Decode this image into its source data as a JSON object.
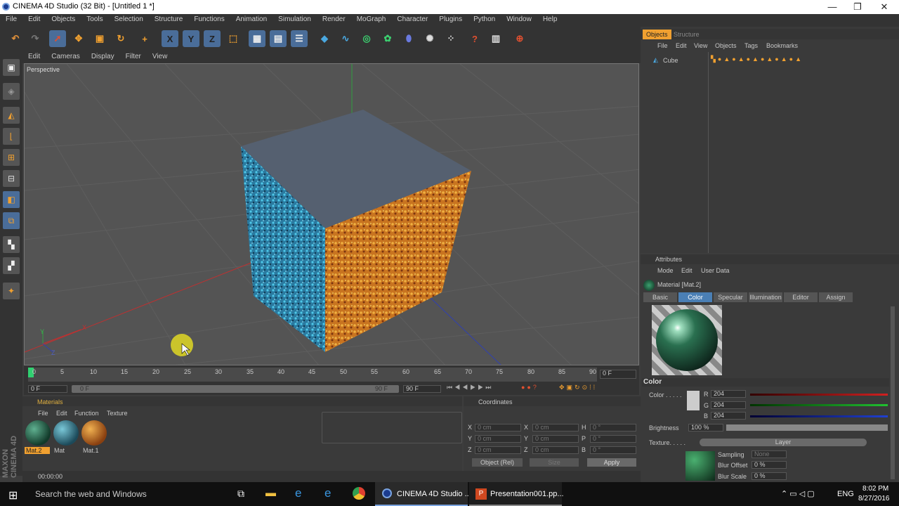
{
  "window": {
    "title": "CINEMA 4D Studio (32 Bit) - [Untitled 1 *]",
    "controls": [
      "—",
      "❐",
      "✕"
    ]
  },
  "menu": [
    "File",
    "Edit",
    "Objects",
    "Tools",
    "Selection",
    "Structure",
    "Functions",
    "Animation",
    "Simulation",
    "Render",
    "MoGraph",
    "Character",
    "Plugins",
    "Python",
    "Window",
    "Help"
  ],
  "viewport": {
    "menu": [
      "Edit",
      "Cameras",
      "Display",
      "Filter",
      "View"
    ],
    "label": "Perspective",
    "axes": {
      "y": "Y",
      "x": "X",
      "z": "Z"
    }
  },
  "toolbar": {
    "x": "X",
    "y": "Y",
    "z": "Z"
  },
  "timeline": {
    "ticks": [
      "0",
      "5",
      "10",
      "15",
      "20",
      "25",
      "30",
      "35",
      "40",
      "45",
      "50",
      "55",
      "60",
      "65",
      "70",
      "75",
      "80",
      "85",
      "90"
    ],
    "current_frame": "0 F",
    "start": "0 F",
    "range_start": "0 F",
    "range_end": "90 F",
    "end": "90 F"
  },
  "materials": {
    "title": "Materials",
    "menu": [
      "File",
      "Edit",
      "Function",
      "Texture"
    ],
    "items": [
      {
        "name": "Mat.2",
        "color": "#1f4a3a"
      },
      {
        "name": "Mat",
        "color": "#2c6a7a"
      },
      {
        "name": "Mat.1",
        "color": "#c87830"
      }
    ]
  },
  "coordinates": {
    "title": "Coordinates",
    "rows": [
      {
        "a": "X",
        "av": "0 cm",
        "b": "X",
        "bv": "0 cm",
        "c": "H",
        "cv": "0 °"
      },
      {
        "a": "Y",
        "av": "0 cm",
        "b": "Y",
        "bv": "0 cm",
        "c": "P",
        "cv": "0 °"
      },
      {
        "a": "Z",
        "av": "0 cm",
        "b": "Z",
        "bv": "0 cm",
        "c": "B",
        "cv": "0 °"
      }
    ],
    "mode": "Object (Rel)",
    "size": "Size",
    "apply": "Apply"
  },
  "status": {
    "time": "00:00:00"
  },
  "objects": {
    "tabs": [
      "Objects",
      "Structure"
    ],
    "menu": [
      "File",
      "Edit",
      "View",
      "Objects",
      "Tags",
      "Bookmarks"
    ],
    "item": "Cube"
  },
  "attributes": {
    "title": "Attributes",
    "menu": [
      "Mode",
      "Edit",
      "User Data"
    ],
    "material": "Material [Mat.2]",
    "tabs": [
      "Basic",
      "Color",
      "Specular",
      "Illumination",
      "Editor",
      "Assign"
    ],
    "active_tab": "Color",
    "section": "Color",
    "color_label": "Color . . . . .",
    "r_label": "R",
    "g_label": "G",
    "b_label": "B",
    "r": "204",
    "g": "204",
    "b": "204",
    "brightness_label": "Brightness",
    "brightness": "100 %",
    "texture_label": "Texture. . . . .",
    "layer": "Layer",
    "sampling_label": "Sampling",
    "sampling": "None",
    "blur_offset_label": "Blur Offset",
    "blur_offset": "0 %",
    "blur_scale_label": "Blur Scale",
    "blur_scale": "0 %",
    "accent": "#4a7fb5"
  },
  "taskbar": {
    "search": "Search the web and Windows",
    "apps": [
      "CINEMA 4D Studio ...",
      "Presentation001.pp..."
    ],
    "lang": "ENG",
    "time": "8:02 PM",
    "date": "8/27/2016"
  },
  "brand": "MAXON CINEMA 4D"
}
